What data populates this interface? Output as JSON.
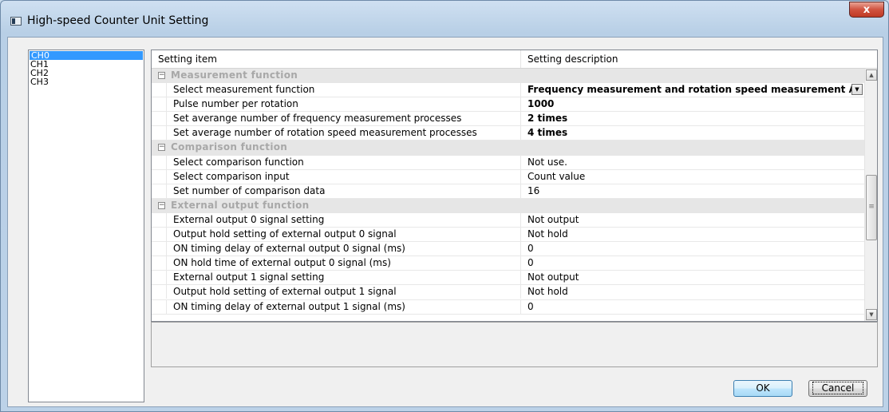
{
  "window": {
    "title": "High-speed Counter Unit Setting",
    "close_label": "x"
  },
  "channels": {
    "items": [
      "CH0",
      "CH1",
      "CH2",
      "CH3"
    ],
    "selected": "CH0"
  },
  "grid": {
    "col_item": "Setting item",
    "col_desc": "Setting description",
    "categories": [
      {
        "name": "Measurement function"
      },
      {
        "name": "Comparison function"
      },
      {
        "name": "External output function"
      }
    ],
    "rows": [
      {
        "item": "Select measurement function",
        "value": "Frequency measurement and rotation speed measurement A"
      },
      {
        "item": "Pulse number per rotation",
        "value": "1000"
      },
      {
        "item": "Set averange number of frequency measurement processes",
        "value": "2 times"
      },
      {
        "item": "Set average number of rotation speed measurement processes",
        "value": "4 times"
      },
      {
        "item": "Select comparison function",
        "value": "Not use."
      },
      {
        "item": "Select comparison input",
        "value": "Count value"
      },
      {
        "item": "Set number of comparison data",
        "value": "16"
      },
      {
        "item": "External output 0 signal setting",
        "value": "Not output"
      },
      {
        "item": "Output hold setting of external output 0 signal",
        "value": "Not hold"
      },
      {
        "item": "ON timing delay of external output 0 signal (ms)",
        "value": "0"
      },
      {
        "item": "ON hold time of external output 0 signal (ms)",
        "value": "0"
      },
      {
        "item": "External output 1 signal setting",
        "value": "Not output"
      },
      {
        "item": "Output hold setting of external output 1 signal",
        "value": "Not hold"
      },
      {
        "item": "ON timing delay of external output 1 signal (ms)",
        "value": "0"
      }
    ],
    "toggle_symbol": "−",
    "dropdown_arrow": "▼"
  },
  "scrollbar": {
    "up_arrow": "▲",
    "down_arrow": "▼",
    "grip": "≡"
  },
  "buttons": {
    "ok": "OK",
    "cancel": "Cancel"
  }
}
